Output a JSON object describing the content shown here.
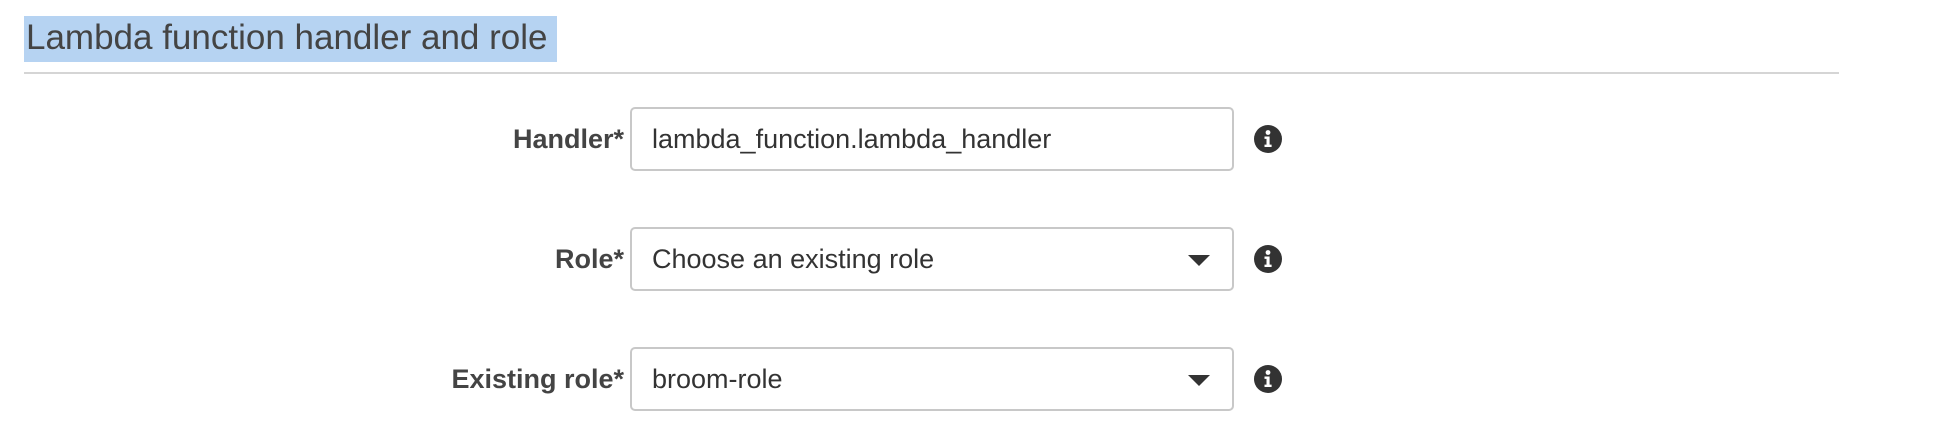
{
  "section": {
    "title": "Lambda function handler and role"
  },
  "form": {
    "handler": {
      "label": "Handler*",
      "value": "lambda_function.lambda_handler"
    },
    "role": {
      "label": "Role*",
      "selected": "Choose an existing role"
    },
    "existing_role": {
      "label": "Existing role*",
      "selected": "broom-role"
    }
  },
  "icons": {
    "info": "info-circle-icon",
    "dropdown": "caret-down-icon"
  },
  "colors": {
    "title_highlight": "#b6d3f2",
    "text": "#333333",
    "label": "#444444",
    "border": "#c8c8c8",
    "divider": "#d5d5d5"
  }
}
